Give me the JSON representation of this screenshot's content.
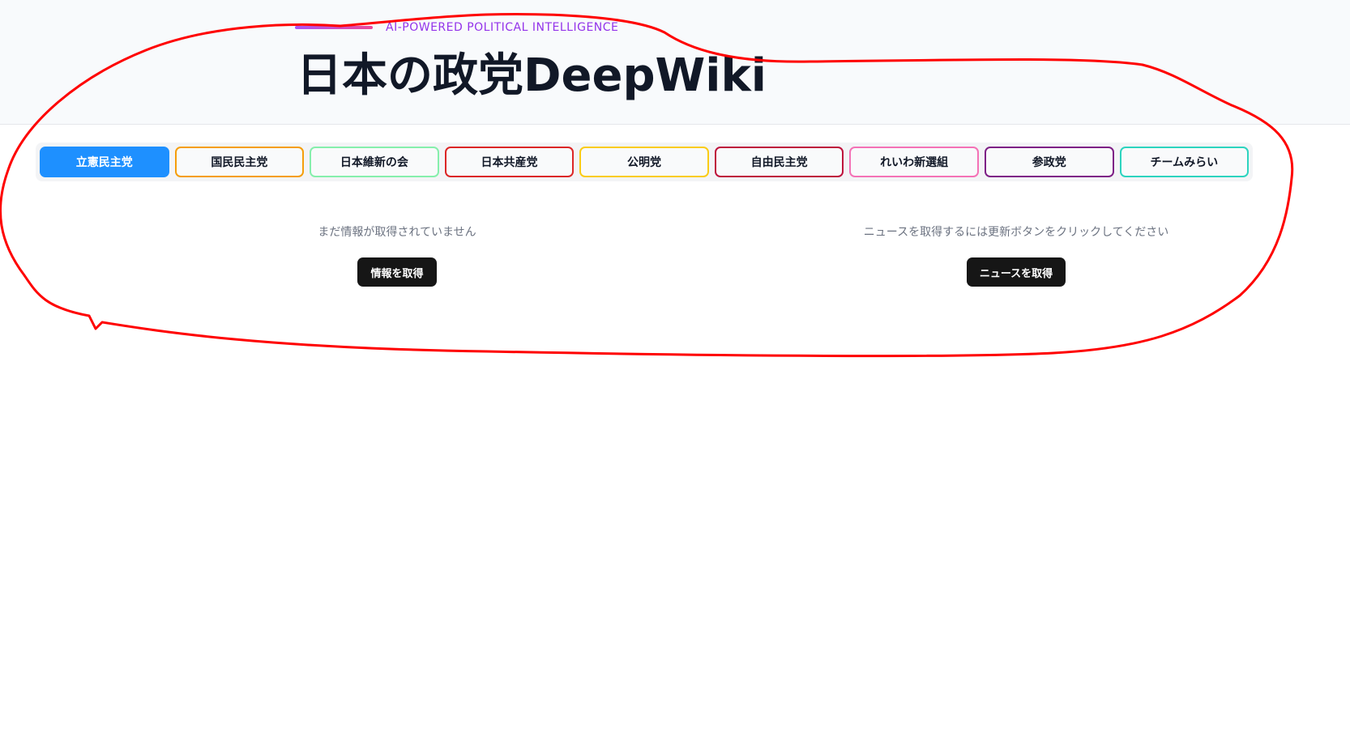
{
  "header": {
    "tagline": "AI-POWERED POLITICAL INTELLIGENCE",
    "title": "日本の政党DeepWiki"
  },
  "tabs": [
    {
      "label": "立憲民主党",
      "color": "#1e90ff",
      "active": true
    },
    {
      "label": "国民民主党",
      "color": "#f59e0b",
      "active": false
    },
    {
      "label": "日本維新の会",
      "color": "#86efac",
      "active": false
    },
    {
      "label": "日本共産党",
      "color": "#dc2626",
      "active": false
    },
    {
      "label": "公明党",
      "color": "#facc15",
      "active": false
    },
    {
      "label": "自由民主党",
      "color": "#be123c",
      "active": false
    },
    {
      "label": "れいわ新選組",
      "color": "#f472b6",
      "active": false
    },
    {
      "label": "参政党",
      "color": "#7e1f86",
      "active": false
    },
    {
      "label": "チームみらい",
      "color": "#2dd4bf",
      "active": false
    }
  ],
  "info_panel": {
    "empty_text": "まだ情報が取得されていません",
    "button_label": "情報を取得"
  },
  "news_panel": {
    "empty_text": "ニュースを取得するには更新ボタンをクリックしてください",
    "button_label": "ニュースを取得"
  },
  "annotation_color": "#ff0000"
}
